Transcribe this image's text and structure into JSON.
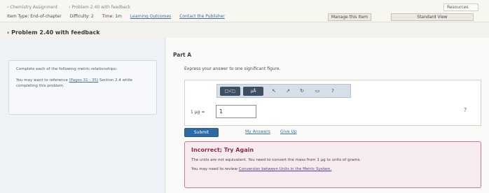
{
  "header": {
    "breadcrumbs": [
      "‹ Chemistry Assignment",
      "‹ Problem 2.40 with feedback"
    ],
    "resources_label": "Resources",
    "toolbar": {
      "item_type": "Item Type: End-of-chapter",
      "difficulty": "Difficulty: 2",
      "time": "Time: 1m",
      "learning_outcomes": "Learning Outcomes",
      "contact_publisher": "Contact the Publisher",
      "manage_button": "Manage this Item",
      "standard_view_button": "Standard View"
    }
  },
  "problem": {
    "title": "‹ Problem 2.40 with feedback"
  },
  "sidebar": {
    "instruction": "Complete each of the following metric relationships:",
    "reference_prefix": "You may want to reference",
    "reference_link": "(Pages 31 - 35)",
    "reference_suffix": "Section 2.4 while completing this problem."
  },
  "main": {
    "part_label": "Part A",
    "prompt": "Express your answer to one significant figure.",
    "toolbar_icons": [
      "templates-icon",
      "symbols-icon",
      "undo-icon",
      "redo-icon",
      "reset-icon",
      "keyboard-icon",
      "help-icon"
    ],
    "big_tool_1": "□√□",
    "big_tool_2": "μÅ",
    "answer_label": "1 μg =",
    "answer_value": "1",
    "unit_placeholder": "?",
    "submit_label": "Submit",
    "previous_answers": "My Answers",
    "give_up": "Give Up"
  },
  "feedback": {
    "title": "Incorrect; Try Again",
    "message": "The units are not equivalent. You need to convert the mass from 1 μg to units of grams.",
    "hint_prefix": "You may need to review",
    "hint_link": "Conversion between Units in the Metric System."
  },
  "colors": {
    "accent": "#2d6aa3",
    "feedback_border": "#c77c93",
    "feedback_title": "#8c2a47"
  }
}
